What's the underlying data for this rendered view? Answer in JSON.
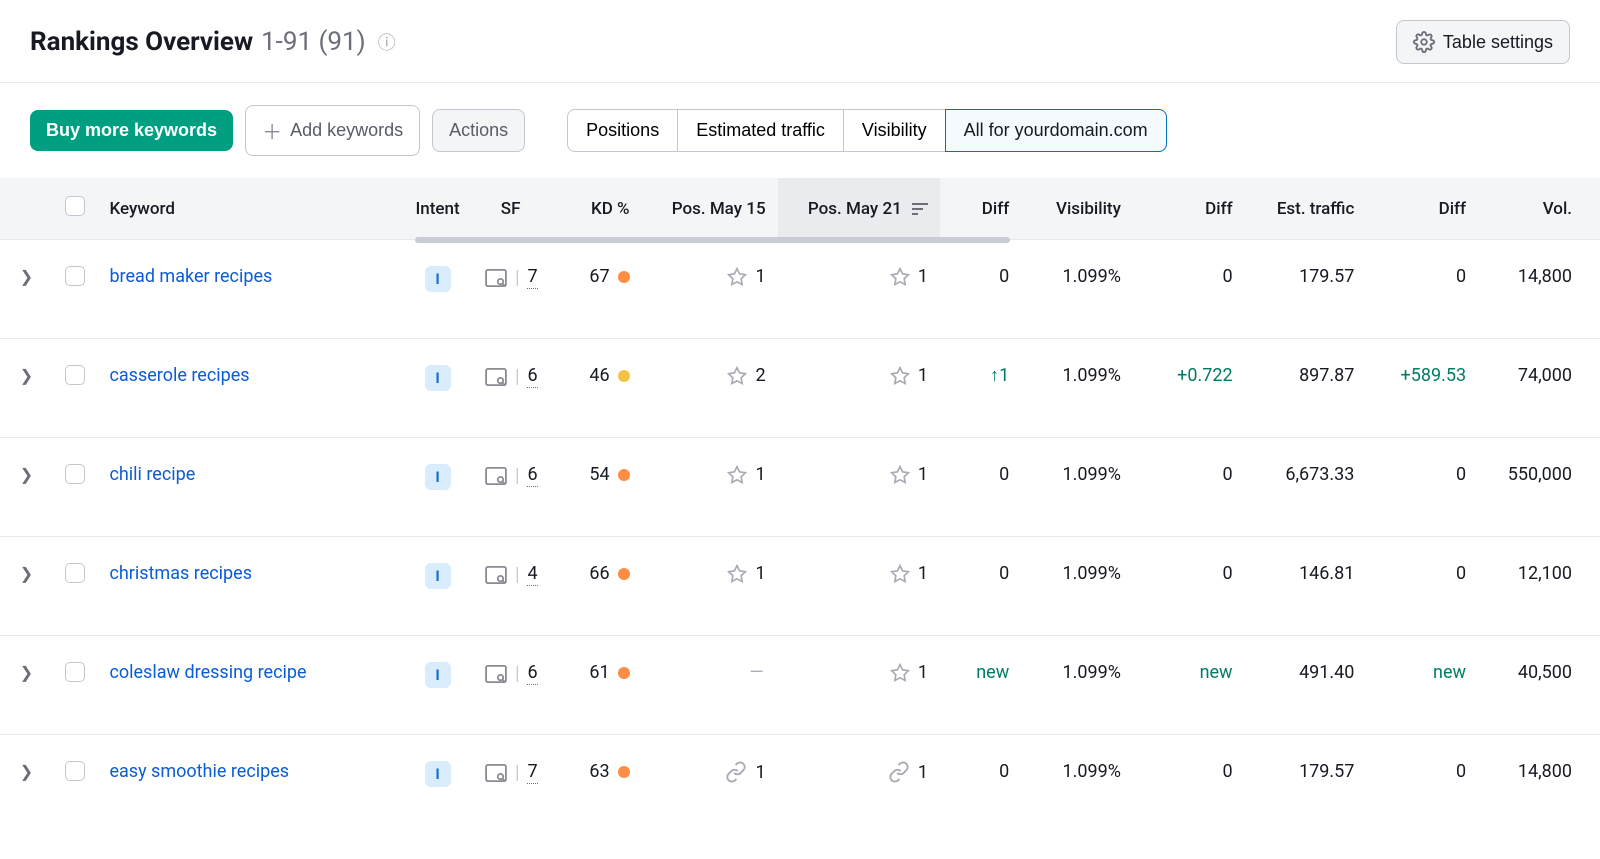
{
  "header": {
    "title": "Rankings Overview",
    "range": "1-91 (91)",
    "settings": "Table settings"
  },
  "toolbar": {
    "buy": "Buy more keywords",
    "add": "Add keywords",
    "actions": "Actions",
    "tabs": [
      "Positions",
      "Estimated traffic",
      "Visibility",
      "All for yourdomain.com"
    ],
    "activeTab": 3
  },
  "columns": {
    "kw": "Keyword",
    "intent": "Intent",
    "sf": "SF",
    "kd": "KD %",
    "pos1": "Pos. May 15",
    "pos2": "Pos. May 21",
    "diff1": "Diff",
    "vis": "Visibility",
    "diff2": "Diff",
    "est": "Est. traffic",
    "diff3": "Diff",
    "vol": "Vol."
  },
  "colors": {
    "kd_orange": "#ff8c43",
    "kd_yellow": "#f6c344"
  },
  "rows": [
    {
      "keyword": "bread maker recipes",
      "intent": "I",
      "sf": "7",
      "kd": "67",
      "kdColor": "kd_orange",
      "pos1": {
        "icon": "star",
        "value": "1"
      },
      "pos2": {
        "icon": "star",
        "value": "1"
      },
      "diff1": "0",
      "diff1Class": "",
      "vis": "1.099%",
      "diff2": "0",
      "diff2Class": "",
      "est": "179.57",
      "diff3": "0",
      "diff3Class": "",
      "vol": "14,800"
    },
    {
      "keyword": "casserole recipes",
      "intent": "I",
      "sf": "6",
      "kd": "46",
      "kdColor": "kd_yellow",
      "pos1": {
        "icon": "star",
        "value": "2"
      },
      "pos2": {
        "icon": "star",
        "value": "1"
      },
      "diff1": "↑1",
      "diff1Class": "green",
      "vis": "1.099%",
      "diff2": "+0.722",
      "diff2Class": "green",
      "est": "897.87",
      "diff3": "+589.53",
      "diff3Class": "green",
      "vol": "74,000"
    },
    {
      "keyword": "chili recipe",
      "intent": "I",
      "sf": "6",
      "kd": "54",
      "kdColor": "kd_orange",
      "pos1": {
        "icon": "star",
        "value": "1"
      },
      "pos2": {
        "icon": "star",
        "value": "1"
      },
      "diff1": "0",
      "diff1Class": "",
      "vis": "1.099%",
      "diff2": "0",
      "diff2Class": "",
      "est": "6,673.33",
      "diff3": "0",
      "diff3Class": "",
      "vol": "550,000"
    },
    {
      "keyword": "christmas recipes",
      "intent": "I",
      "sf": "4",
      "kd": "66",
      "kdColor": "kd_orange",
      "pos1": {
        "icon": "star",
        "value": "1"
      },
      "pos2": {
        "icon": "star",
        "value": "1"
      },
      "diff1": "0",
      "diff1Class": "",
      "vis": "1.099%",
      "diff2": "0",
      "diff2Class": "",
      "est": "146.81",
      "diff3": "0",
      "diff3Class": "",
      "vol": "12,100"
    },
    {
      "keyword": "coleslaw dressing recipe",
      "intent": "I",
      "sf": "6",
      "kd": "61",
      "kdColor": "kd_orange",
      "pos1": {
        "icon": "dash",
        "value": "—"
      },
      "pos2": {
        "icon": "star",
        "value": "1"
      },
      "diff1": "new",
      "diff1Class": "green",
      "vis": "1.099%",
      "diff2": "new",
      "diff2Class": "green",
      "est": "491.40",
      "diff3": "new",
      "diff3Class": "green",
      "vol": "40,500"
    },
    {
      "keyword": "easy smoothie recipes",
      "intent": "I",
      "sf": "7",
      "kd": "63",
      "kdColor": "kd_orange",
      "pos1": {
        "icon": "link",
        "value": "1"
      },
      "pos2": {
        "icon": "link",
        "value": "1"
      },
      "diff1": "0",
      "diff1Class": "",
      "vis": "1.099%",
      "diff2": "0",
      "diff2Class": "",
      "est": "179.57",
      "diff3": "0",
      "diff3Class": "",
      "vol": "14,800"
    }
  ]
}
